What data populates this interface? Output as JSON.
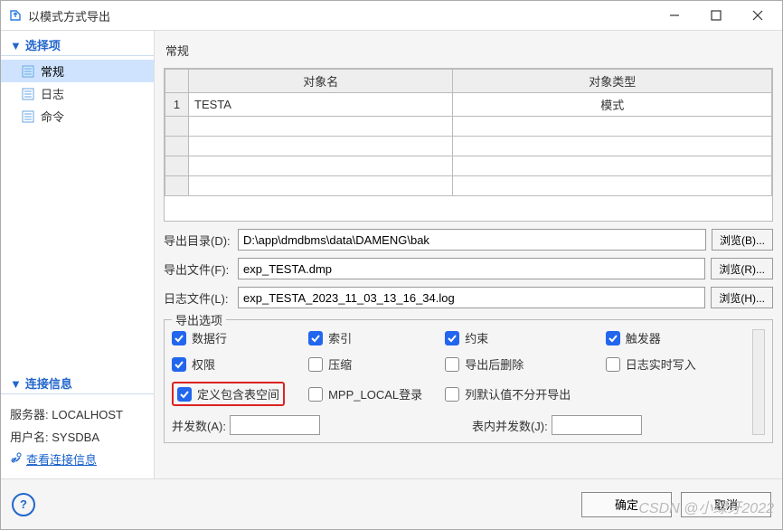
{
  "window": {
    "title": "以模式方式导出"
  },
  "sidebar": {
    "options_header": "选择项",
    "items": [
      {
        "label": "常规"
      },
      {
        "label": "日志"
      },
      {
        "label": "命令"
      }
    ],
    "conn_header": "连接信息",
    "server_label": "服务器:",
    "server_value": "LOCALHOST",
    "user_label": "用户名:",
    "user_value": "SYSDBA",
    "view_conn_link": "查看连接信息"
  },
  "main": {
    "title": "常规",
    "table": {
      "cols": [
        "对象名",
        "对象类型"
      ],
      "rows": [
        {
          "n": "1",
          "name": "TESTA",
          "type": "模式"
        }
      ]
    },
    "export_dir_label": "导出目录(D):",
    "export_dir_value": "D:\\app\\dmdbms\\data\\DAMENG\\bak",
    "export_file_label": "导出文件(F):",
    "export_file_value": "exp_TESTA.dmp",
    "log_file_label": "日志文件(L):",
    "log_file_value": "exp_TESTA_2023_11_03_13_16_34.log",
    "browse_b": "浏览(B)...",
    "browse_r": "浏览(R)...",
    "browse_h": "浏览(H)...",
    "options_title": "导出选项",
    "opts": {
      "data_rows": "数据行",
      "index": "索引",
      "constraint": "约束",
      "trigger": "触发器",
      "privilege": "权限",
      "compress": "压缩",
      "del_after": "导出后删除",
      "log_realtime": "日志实时写入",
      "tablespace": "定义包含表空间",
      "mpp": "MPP_LOCAL登录",
      "col_default": "列默认值不分开导出"
    },
    "concurrency_a_label": "并发数(A):",
    "concurrency_j_label": "表内并发数(J):"
  },
  "footer": {
    "ok": "确定",
    "cancel": "取消"
  },
  "watermark": "CSDN @小绿牙2022"
}
